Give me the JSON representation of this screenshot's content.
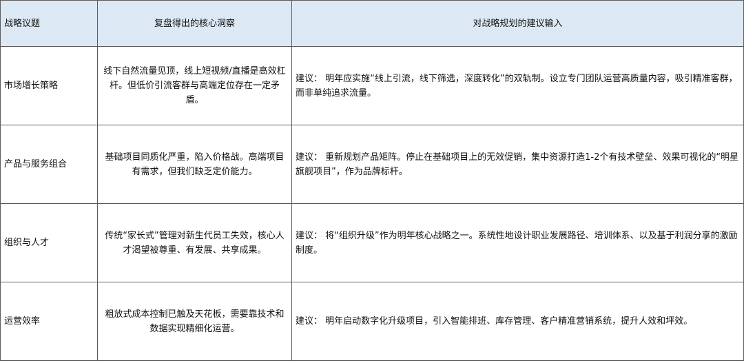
{
  "table": {
    "headers": {
      "topic": "战略议题",
      "insight": "复盘得出的核心洞察",
      "suggestion": "对战略规划的建议输入"
    },
    "rows": [
      {
        "topic": "市场增长策略",
        "insight": "线下自然流量见顶，线上短视频/直播是高效杠杆。但低价引流客群与高端定位存在一定矛盾。",
        "suggestion": "建议： 明年应实施“线上引流，线下筛选，深度转化”的双轨制。设立专门团队运营高质量内容，吸引精准客群，而非单纯追求流量。"
      },
      {
        "topic": "产品与服务组合",
        "insight": "基础项目同质化严重，陷入价格战。高端项目有需求，但我们缺乏定价能力。",
        "suggestion": "建议： 重新规划产品矩阵。停止在基础项目上的无效促销，集中资源打造1-2个有技术壁垒、效果可视化的“明星旗舰项目”，作为品牌标杆。"
      },
      {
        "topic": "组织与人才",
        "insight": "传统“家长式”管理对新生代员工失效，核心人才渴望被尊重、有发展、共享成果。",
        "suggestion": "建议： 将“组织升级”作为明年核心战略之一。系统性地设计职业发展路径、培训体系、以及基于利润分享的激励制度。"
      },
      {
        "topic": "运营效率",
        "insight": "粗放式成本控制已触及天花板，需要靠技术和数据实现精细化运营。",
        "suggestion": "建议： 明年启动数字化升级项目，引入智能排班、库存管理、客户精准营销系统，提升人效和坪效。"
      }
    ]
  },
  "colors": {
    "header_background": "#dce9f5",
    "border": "#5b5b5b",
    "text": "#111111"
  }
}
